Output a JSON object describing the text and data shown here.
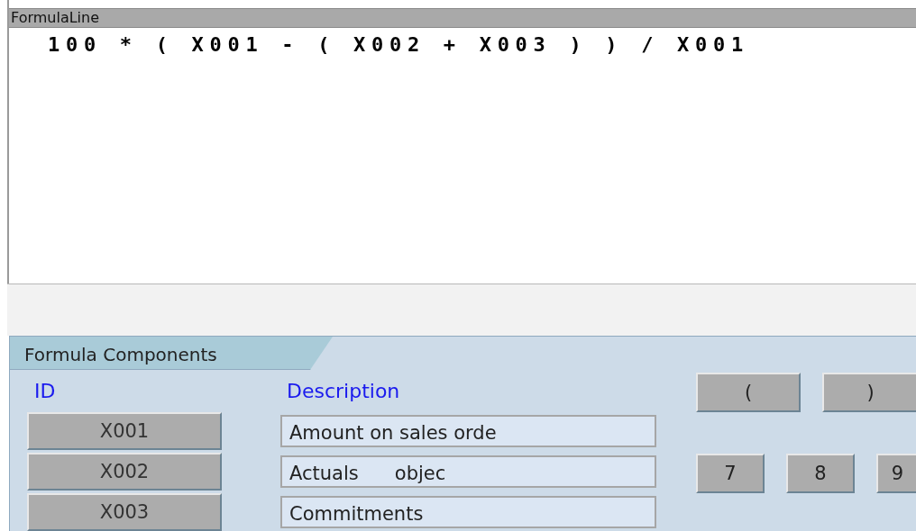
{
  "header": {
    "title": "FormulaLine"
  },
  "formula": "100 * ( X001 - ( X002 + X003 ) ) / X001",
  "components": {
    "title": "Formula Components",
    "columns": [
      "ID",
      "Description"
    ],
    "rows": [
      {
        "id": "X001",
        "description": "Amount on sales orde"
      },
      {
        "id": "X002",
        "description": "Actuals      objec"
      },
      {
        "id": "X003",
        "description": "Commitments"
      }
    ]
  },
  "operator_buttons": [
    "(",
    ")"
  ],
  "digit_buttons": [
    "7",
    "8",
    "9"
  ]
}
